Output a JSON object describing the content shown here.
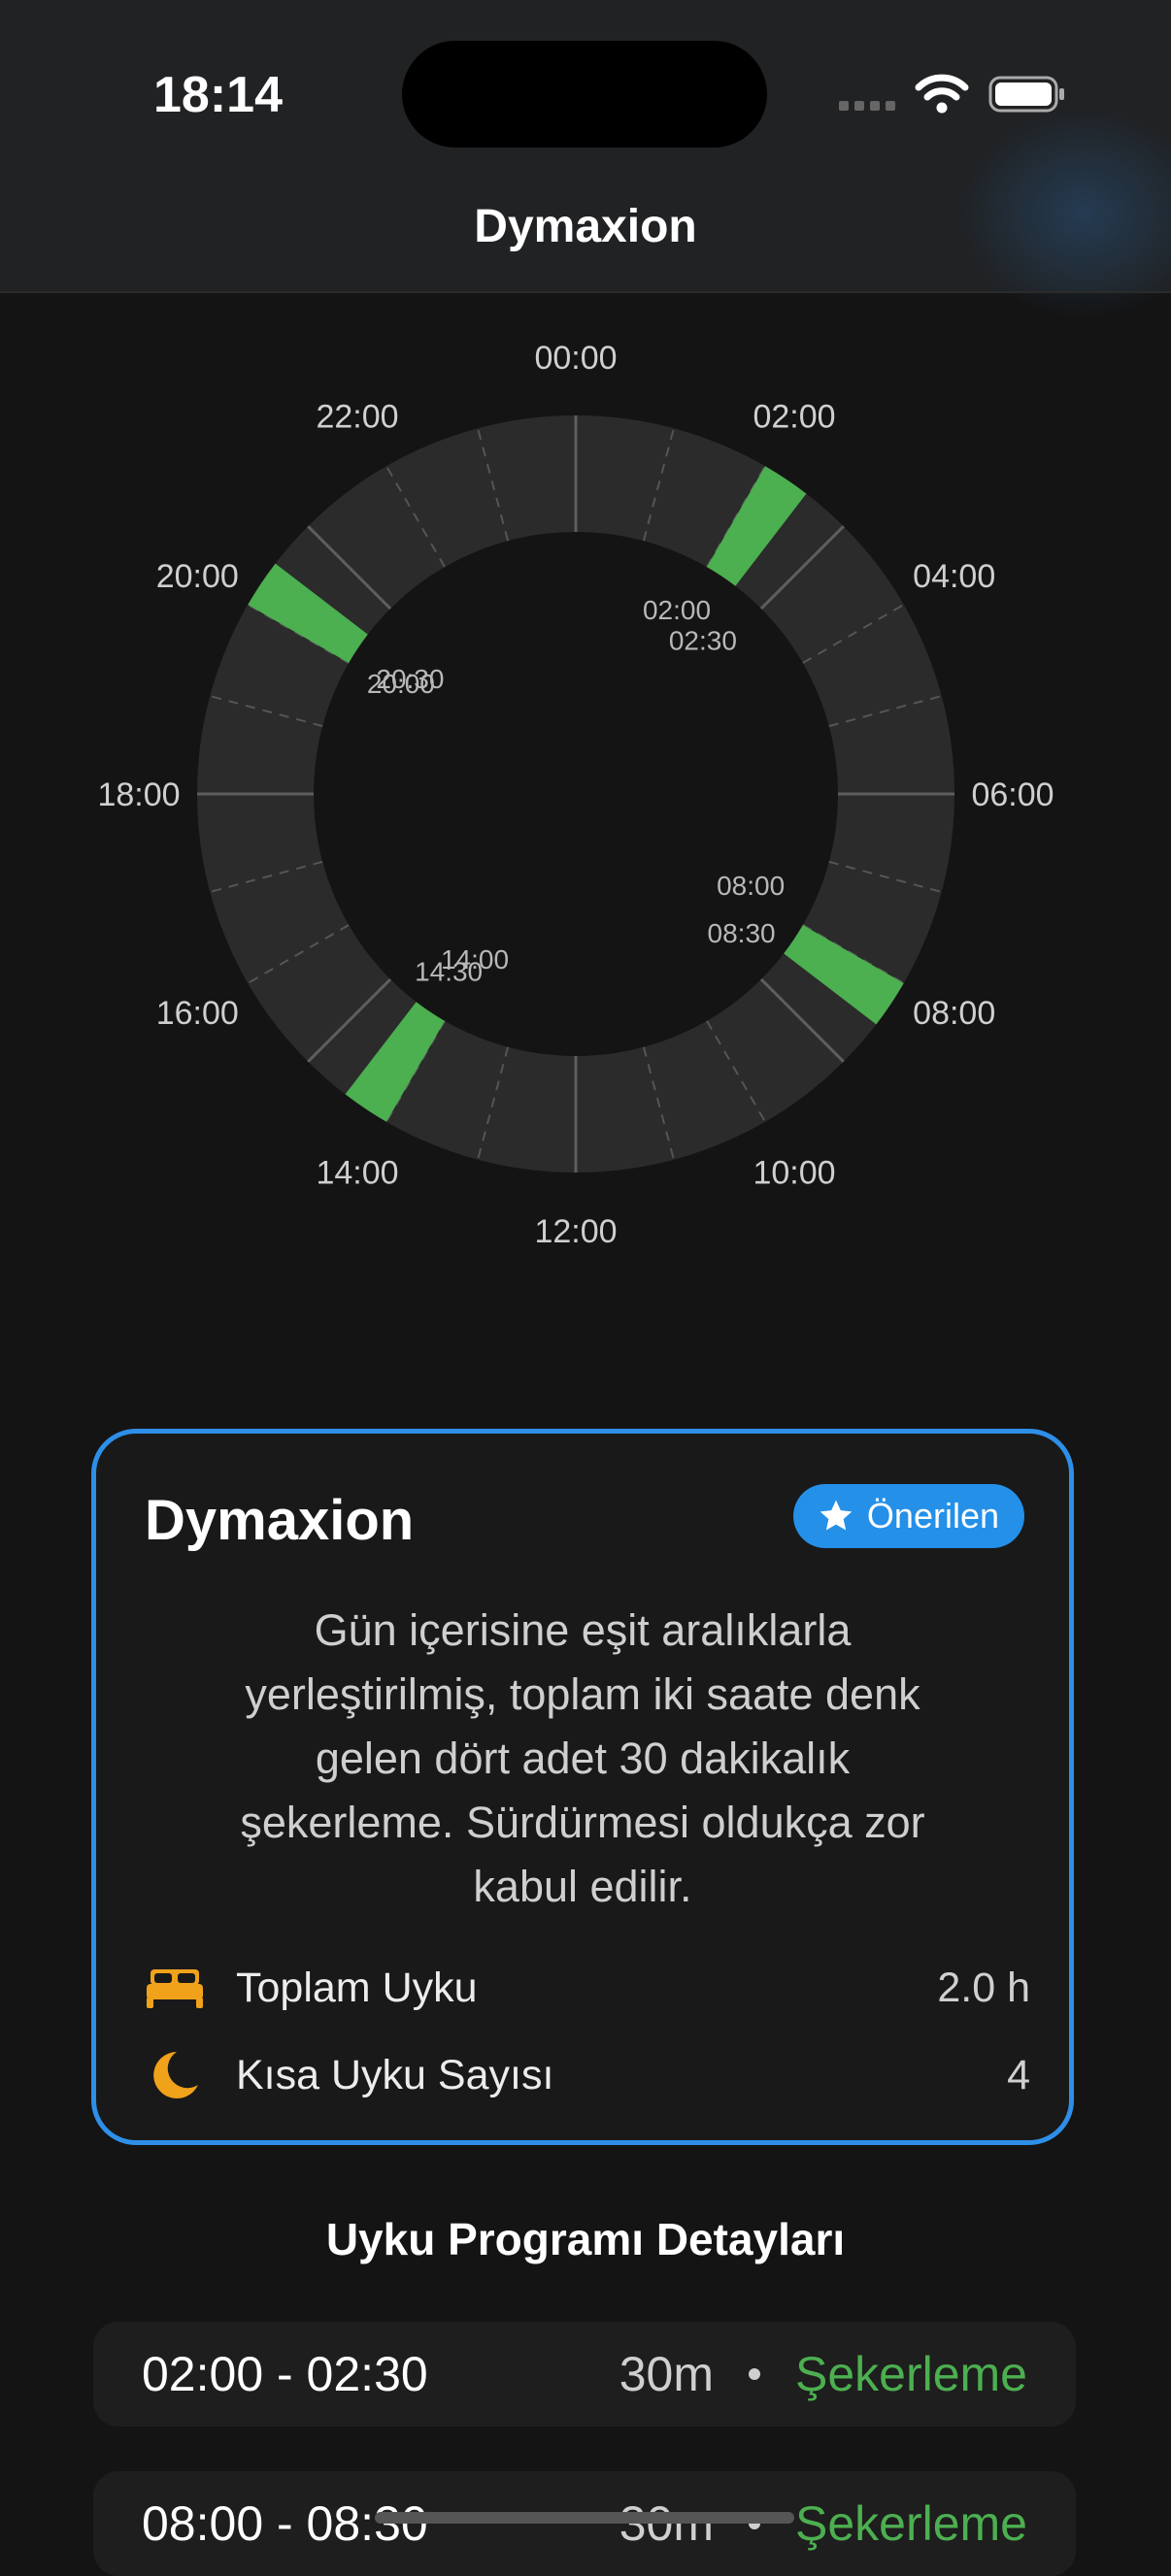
{
  "status_bar": {
    "time": "18:14"
  },
  "nav": {
    "title": "Dymaxion"
  },
  "clock": {
    "hour_labels": [
      "00:00",
      "02:00",
      "04:00",
      "06:00",
      "08:00",
      "10:00",
      "12:00",
      "14:00",
      "16:00",
      "18:00",
      "20:00",
      "22:00"
    ],
    "naps": [
      {
        "start": "02:00",
        "end": "02:30"
      },
      {
        "start": "08:00",
        "end": "08:30"
      },
      {
        "start": "14:00",
        "end": "14:30"
      },
      {
        "start": "20:00",
        "end": "20:30"
      }
    ],
    "nap_color": "#4caf50",
    "ring_color": "#2b2b2b"
  },
  "card": {
    "title": "Dymaxion",
    "badge": "Önerilen",
    "desc_lines": [
      "Gün içerisine eşit aralıklarla",
      "yerleştirilmiş, toplam iki saate denk",
      "gelen dört adet 30 dakikalık",
      "şekerleme. Sürdürmesi oldukça zor",
      "kabul edilir."
    ],
    "total_label": "Toplam Uyku",
    "total_value": "2.0 h",
    "count_label": "Kısa Uyku Sayısı",
    "count_value": "4",
    "accent_color": "#2e8fe8",
    "icon_color": "#f0a21a"
  },
  "details": {
    "title": "Uyku Programı Detayları",
    "rows": [
      {
        "range": "02:00 - 02:30",
        "duration": "30m",
        "type": "Şekerleme"
      },
      {
        "range": "08:00 - 08:30",
        "duration": "30m",
        "type": "Şekerleme"
      }
    ]
  }
}
